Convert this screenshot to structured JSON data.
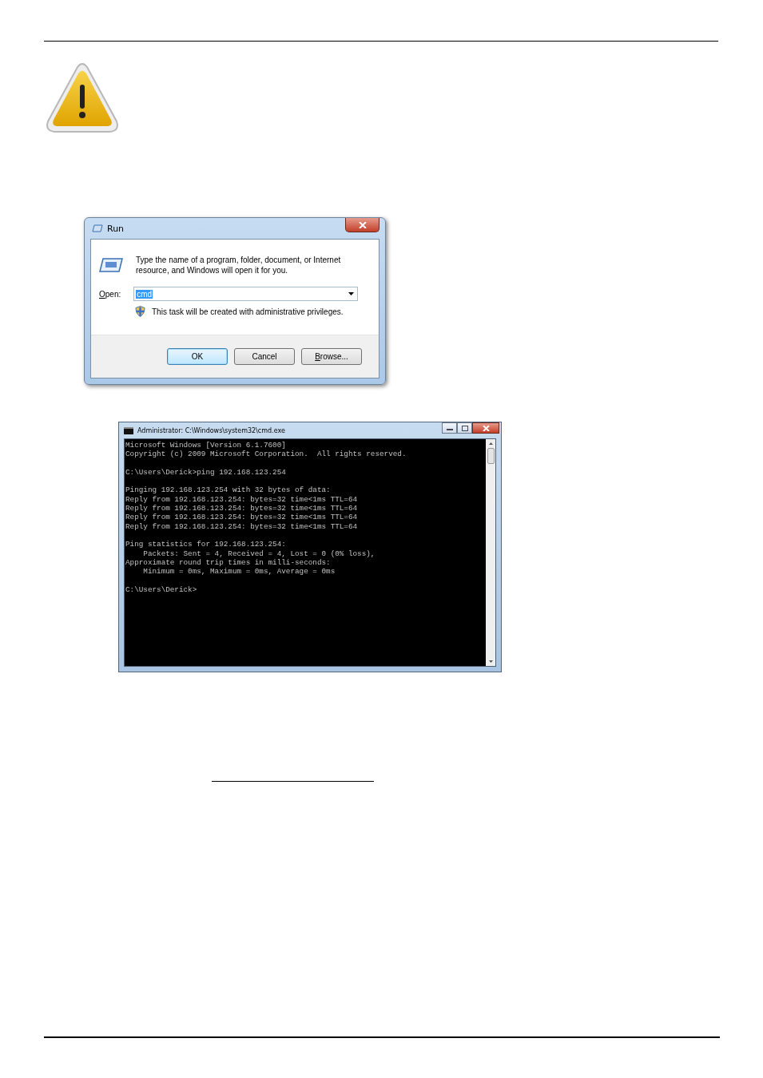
{
  "run_dialog": {
    "title": "Run",
    "message": "Type the name of a program, folder, document, or Internet resource, and Windows will open it for you.",
    "open_label": {
      "text": "Open:",
      "mnemonic_first": true
    },
    "open_value": "cmd",
    "value_selected": true,
    "admin_note": "This task will be created with administrative privileges.",
    "buttons": [
      {
        "label": "OK",
        "default": true,
        "mnemonic_first": false
      },
      {
        "label": "Cancel",
        "default": false,
        "mnemonic_first": false
      },
      {
        "label": "Browse...",
        "default": false,
        "mnemonic_first": true
      }
    ]
  },
  "cmd_window": {
    "title": "Administrator: C:\\Windows\\system32\\cmd.exe",
    "blocks": [
      [
        "Microsoft Windows [Version 6.1.7600]",
        "Copyright (c) 2009 Microsoft Corporation.  All rights reserved."
      ],
      [
        "C:\\Users\\Derick>ping 192.168.123.254"
      ],
      [
        "Pinging 192.168.123.254 with 32 bytes of data:",
        "Reply from 192.168.123.254: bytes=32 time<1ms TTL=64",
        "Reply from 192.168.123.254: bytes=32 time<1ms TTL=64",
        "Reply from 192.168.123.254: bytes=32 time<1ms TTL=64",
        "Reply from 192.168.123.254: bytes=32 time<1ms TTL=64"
      ],
      [
        "Ping statistics for 192.168.123.254:",
        "    Packets: Sent = 4, Received = 4, Lost = 0 (0% loss),",
        "Approximate round trip times in milli-seconds:",
        "    Minimum = 0ms, Maximum = 0ms, Average = 0ms"
      ],
      [
        "C:\\Users\\Derick>"
      ]
    ]
  }
}
